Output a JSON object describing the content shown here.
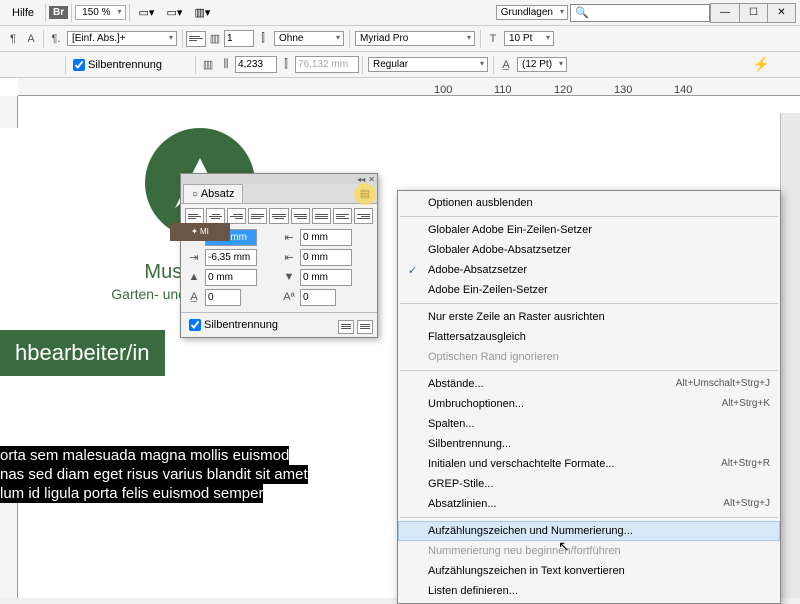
{
  "menu": {
    "help": "Hilfe",
    "br": "Br",
    "zoom": "150 %",
    "workspace": "Grundlagen"
  },
  "control_bar": {
    "style": "[Einf. Abs.]+",
    "hyphenation": "Silbentrennung",
    "cols": "1",
    "gutter": "Ohne",
    "spacing": "4,233",
    "width": "76,132 mm",
    "font": "Myriad Pro",
    "font_style": "Regular",
    "size": "10 Pt",
    "leading": "(12 Pt)"
  },
  "ruler": {
    "t100": "100",
    "t110": "110",
    "t120": "120",
    "t130": "130",
    "t140": "140"
  },
  "page": {
    "ribbon": "✦ MI",
    "name": "Mustermann",
    "sub": "Garten- und Landschaftsbau",
    "job": "hbearbeiter/in",
    "lorem1": "orta sem malesuada magna mollis euismod",
    "lorem2": "nas sed diam eget risus varius blandit sit amet",
    "lorem3": "lum id ligula porta felis euismod semper"
  },
  "panel": {
    "title": "Absatz",
    "left_indent": "6,35 mm",
    "first_line": "-6,35 mm",
    "space_before": "0 mm",
    "dropcap_lines": "0",
    "right_indent": "0 mm",
    "last_line": "0 mm",
    "space_after": "0 mm",
    "dropcap_chars": "0",
    "hyphenation": "Silbentrennung"
  },
  "ctx": {
    "hide_options": "Optionen ausblenden",
    "single_line": "Globaler Adobe Ein-Zeilen-Setzer",
    "paragraph_comp": "Globaler Adobe-Absatzsetzer",
    "adobe_para": "Adobe-Absatzsetzer",
    "adobe_single": "Adobe Ein-Zeilen-Setzer",
    "grid_first": "Nur erste Zeile an Raster ausrichten",
    "balance": "Flattersatzausgleich",
    "optical": "Optischen Rand ignorieren",
    "spacing": "Abstände...",
    "spacing_sc": "Alt+Umschalt+Strg+J",
    "keep": "Umbruchoptionen...",
    "keep_sc": "Alt+Strg+K",
    "columns": "Spalten...",
    "hyphen": "Silbentrennung...",
    "nested": "Initialen und verschachtelte Formate...",
    "nested_sc": "Alt+Strg+R",
    "grep": "GREP-Stile...",
    "rules": "Absatzlinien...",
    "rules_sc": "Alt+Strg+J",
    "bullets": "Aufzählungszeichen und Nummerierung...",
    "restart": "Nummerierung neu beginnen/fortführen",
    "convert": "Aufzählungszeichen in Text konvertieren",
    "define": "Listen definieren..."
  }
}
